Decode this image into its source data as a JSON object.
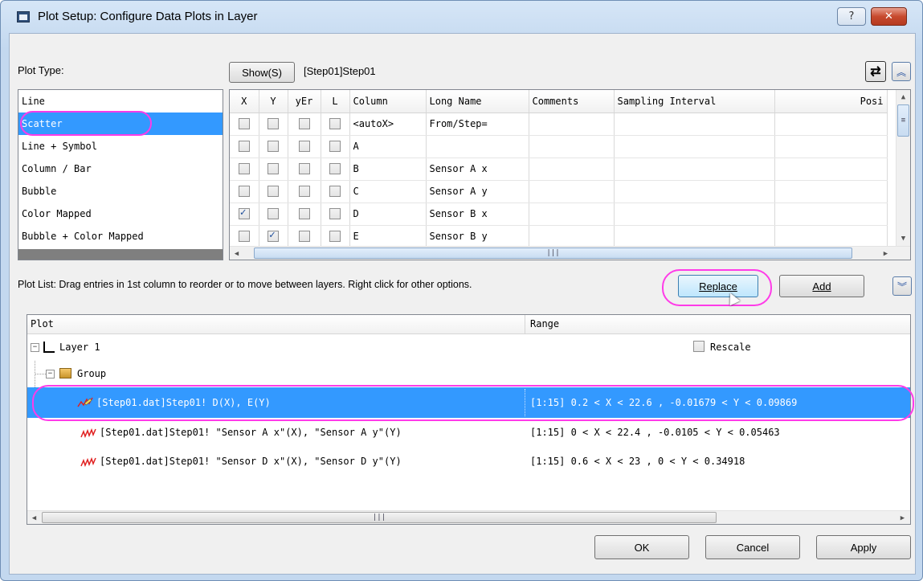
{
  "window": {
    "title": "Plot Setup: Configure Data Plots in Layer",
    "help_label": "?",
    "close_label": "✕"
  },
  "plot_type": {
    "label": "Plot Type:",
    "items": [
      "Line",
      "Scatter",
      "Line + Symbol",
      "Column / Bar",
      "Bubble",
      "Color Mapped",
      "Bubble + Color Mapped"
    ],
    "selected": "Scatter"
  },
  "source": {
    "show_button": "Show(S)",
    "book_name": "[Step01]Step01"
  },
  "columns_table": {
    "headers": [
      "X",
      "Y",
      "yEr",
      "L",
      "Column",
      "Long Name",
      "Comments",
      "Sampling Interval",
      "Posi"
    ],
    "rows": [
      {
        "x": false,
        "y": false,
        "yer": false,
        "l": false,
        "column": "<autoX>",
        "long_name": "From/Step=",
        "comments": "",
        "sampling": ""
      },
      {
        "x": false,
        "y": false,
        "yer": false,
        "l": false,
        "column": "A",
        "long_name": "",
        "comments": "",
        "sampling": ""
      },
      {
        "x": false,
        "y": false,
        "yer": false,
        "l": false,
        "column": "B",
        "long_name": "Sensor A x",
        "comments": "",
        "sampling": ""
      },
      {
        "x": false,
        "y": false,
        "yer": false,
        "l": false,
        "column": "C",
        "long_name": "Sensor A y",
        "comments": "",
        "sampling": ""
      },
      {
        "x": true,
        "y": false,
        "yer": false,
        "l": false,
        "column": "D",
        "long_name": "Sensor B x",
        "comments": "",
        "sampling": ""
      },
      {
        "x": false,
        "y": true,
        "yer": false,
        "l": false,
        "column": "E",
        "long_name": "Sensor B y",
        "comments": "",
        "sampling": ""
      }
    ]
  },
  "plot_list": {
    "hint": "Plot List: Drag entries in 1st column to reorder or to move between layers. Right click for other options.",
    "replace_label": "Replace",
    "add_label": "Add",
    "headers": {
      "plot": "Plot",
      "range": "Range"
    },
    "layer_label": "Layer 1",
    "rescale_label": "Rescale",
    "group_label": "Group",
    "entries": [
      {
        "plot": "[Step01.dat]Step01! D(X), E(Y)",
        "range": "[1:15]  0.2 < X < 22.6 , -0.01679 < Y < 0.09869"
      },
      {
        "plot": "[Step01.dat]Step01! \"Sensor A x\"(X), \"Sensor A y\"(Y)",
        "range": "[1:15]  0 < X < 22.4 , -0.0105 < Y < 0.05463"
      },
      {
        "plot": "[Step01.dat]Step01! \"Sensor D x\"(X), \"Sensor D y\"(Y)",
        "range": "[1:15]  0.6 < X < 23 , 0 < Y < 0.34918"
      }
    ]
  },
  "footer": {
    "ok_label": "OK",
    "cancel_label": "Cancel",
    "apply_label": "Apply"
  },
  "icons": {
    "swap": "swap-arrows-icon",
    "collapse_up": "double-chevron-up-icon",
    "expand_down": "double-chevron-down-icon"
  },
  "colors": {
    "selection": "#3399ff",
    "highlight": "#ff3be8"
  }
}
